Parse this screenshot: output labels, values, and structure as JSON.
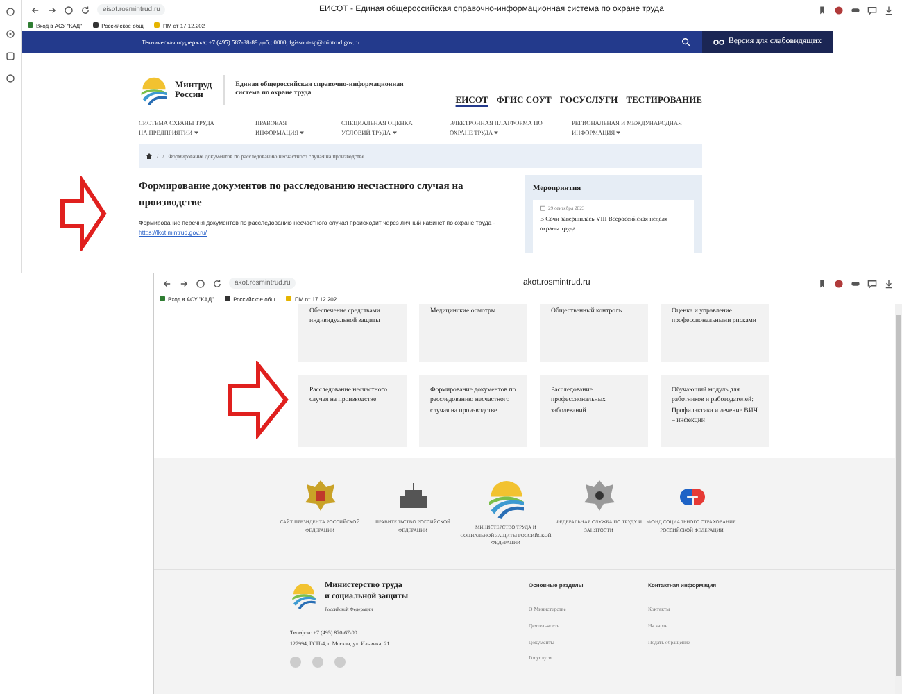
{
  "first_window": {
    "browser": {
      "address": "eisot.rosmintrud.ru",
      "title": "ЕИСОТ - Единая общероссийская справочно-информационная система по охране труда",
      "bookmarks": [
        "Вход в АСУ \"КАД\"",
        "Российское общ",
        "ПМ от 17.12.202"
      ]
    },
    "support_bar": {
      "text": "Техническая поддержка: +7 (495) 587-88-89 доб.: 0000, fgissout-sp@mintrud.gov.ru",
      "accessibility_button": "Версия для слабовидящих"
    },
    "logo_text": [
      "Минтруд",
      "России"
    ],
    "site_title": "Единая общероссийская справочно-информационная система по охране труда",
    "top_links": [
      {
        "label": "ЕИСОТ",
        "selected": true
      },
      {
        "label": "ФГИС СОУТ",
        "selected": false
      },
      {
        "label": "ГОСУСЛУГИ",
        "selected": false
      },
      {
        "label": "ТЕСТИРОВАНИЕ",
        "selected": false
      }
    ],
    "menu": [
      "СИСТЕМА ОХРАНЫ ТРУДА НА ПРЕДПРИЯТИИ",
      "ПРАВОВАЯ ИНФОРМАЦИЯ",
      "СПЕЦИАЛЬНАЯ ОЦЕНКА УСЛОВИЙ ТРУДА",
      "ЭЛЕКТРОННАЯ ПЛАТФОРМА ПО ОХРАНЕ ТРУДА",
      "РЕГИОНАЛЬНАЯ И МЕЖДУНАРОДНАЯ ИНФОРМАЦИЯ"
    ],
    "breadcrumb": {
      "separators": [
        "/",
        "/"
      ],
      "current": "Формирование документов по расследованию несчастного случая на производстве"
    },
    "heading": "Формирование документов по расследованию несчастного случая на производстве",
    "paragraph": {
      "text": "Формирование перечня документов по расследованию несчастного случая происходит через личный кабинет по охране труда - ",
      "link": "https://lkot.mintrud.gov.ru/"
    },
    "events": {
      "title": "Мероприятия",
      "items": [
        {
          "date": "29 сентября 2023",
          "text": "В Сочи завершилась VIII Всероссийская неделя охраны труда"
        }
      ]
    }
  },
  "second_window": {
    "browser": {
      "address": "akot.rosmintrud.ru",
      "title": "akot.rosmintrud.ru",
      "bookmarks": [
        "Вход в АСУ \"КАД\"",
        "Российское общ",
        "ПМ от 17.12.202"
      ]
    },
    "tiles": [
      "Обеспечение средствами индивидуальной защиты",
      "Медицинские осмотры",
      "Общественный контроль",
      "Оценка и управление профессиональными рисками",
      "Расследование несчастного случая на производстве",
      "Формирование документов по расследованию несчастного случая на производстве",
      "Расследование профессиональных заболеваний",
      "Обучающий модуль для работников и работодателей: Профилактика и лечение ВИЧ – инфекции"
    ],
    "partners": [
      {
        "kind": "emblem",
        "label": "САЙТ ПРЕЗИДЕНТА РОССИЙСКОЙ ФЕДЕРАЦИИ"
      },
      {
        "kind": "building",
        "label": "ПРАВИТЕЛЬСТВО РОССИЙСКОЙ ФЕДЕРАЦИИ"
      },
      {
        "kind": "ministry",
        "label": "МИНИСТЕРСТВО ТРУДА И СОЦИАЛЬНОЙ ЗАЩИТЫ РОССИЙСКОЙ ФЕДЕРАЦИИ"
      },
      {
        "kind": "service",
        "label": "ФЕДЕРАЛЬНАЯ СЛУЖБА ПО ТРУДУ И ЗАНЯТОСТИ"
      },
      {
        "kind": "fund",
        "label": "ФОНД СОЦИАЛЬНОГО СТРАХОВАНИЯ РОССИЙСКОЙ ФЕДЕРАЦИИ"
      }
    ],
    "footer": {
      "ministry": [
        "Министерство труда",
        "и социальной защиты"
      ],
      "country": "Российской Федерации",
      "phone": "Телефон: +7 (495) 870-67-00",
      "address": "127994, ГСП-4, г. Москва, ул. Ильинка, 21",
      "sections": [
        {
          "title": "Основные разделы",
          "links": [
            "О Министерстве",
            "Деятельность",
            "Документы",
            "Госуслуги"
          ]
        },
        {
          "title": "Контактная информация",
          "links": [
            "Контакты",
            "На карте",
            "Подать обращение"
          ]
        }
      ]
    }
  }
}
